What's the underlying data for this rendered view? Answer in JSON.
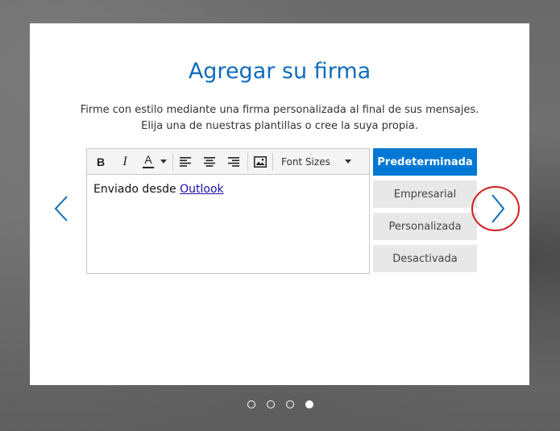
{
  "dialog": {
    "title": "Agregar su firma",
    "description_line1": "Firme con estilo mediante una firma personalizada al final de sus mensajes.",
    "description_line2": "Elija una de nuestras plantillas o cree la suya propia."
  },
  "editor": {
    "toolbar": {
      "bold": "B",
      "italic": "I",
      "font_color": "A",
      "font_sizes": "Font Sizes"
    },
    "body_text": "Enviado desde ",
    "body_link": "Outlook"
  },
  "options": [
    {
      "label": "Predeterminada",
      "selected": true
    },
    {
      "label": "Empresarial",
      "selected": false
    },
    {
      "label": "Personalizada",
      "selected": false
    },
    {
      "label": "Desactivada",
      "selected": false
    }
  ],
  "navigation": {
    "prev_icon": "chevron-left-icon",
    "next_icon": "chevron-right-icon",
    "highlight_color": "#d41e1e",
    "page_count": 4,
    "current_page": 4
  },
  "colors": {
    "accent": "#0078d4",
    "title": "#0f6cbd"
  }
}
